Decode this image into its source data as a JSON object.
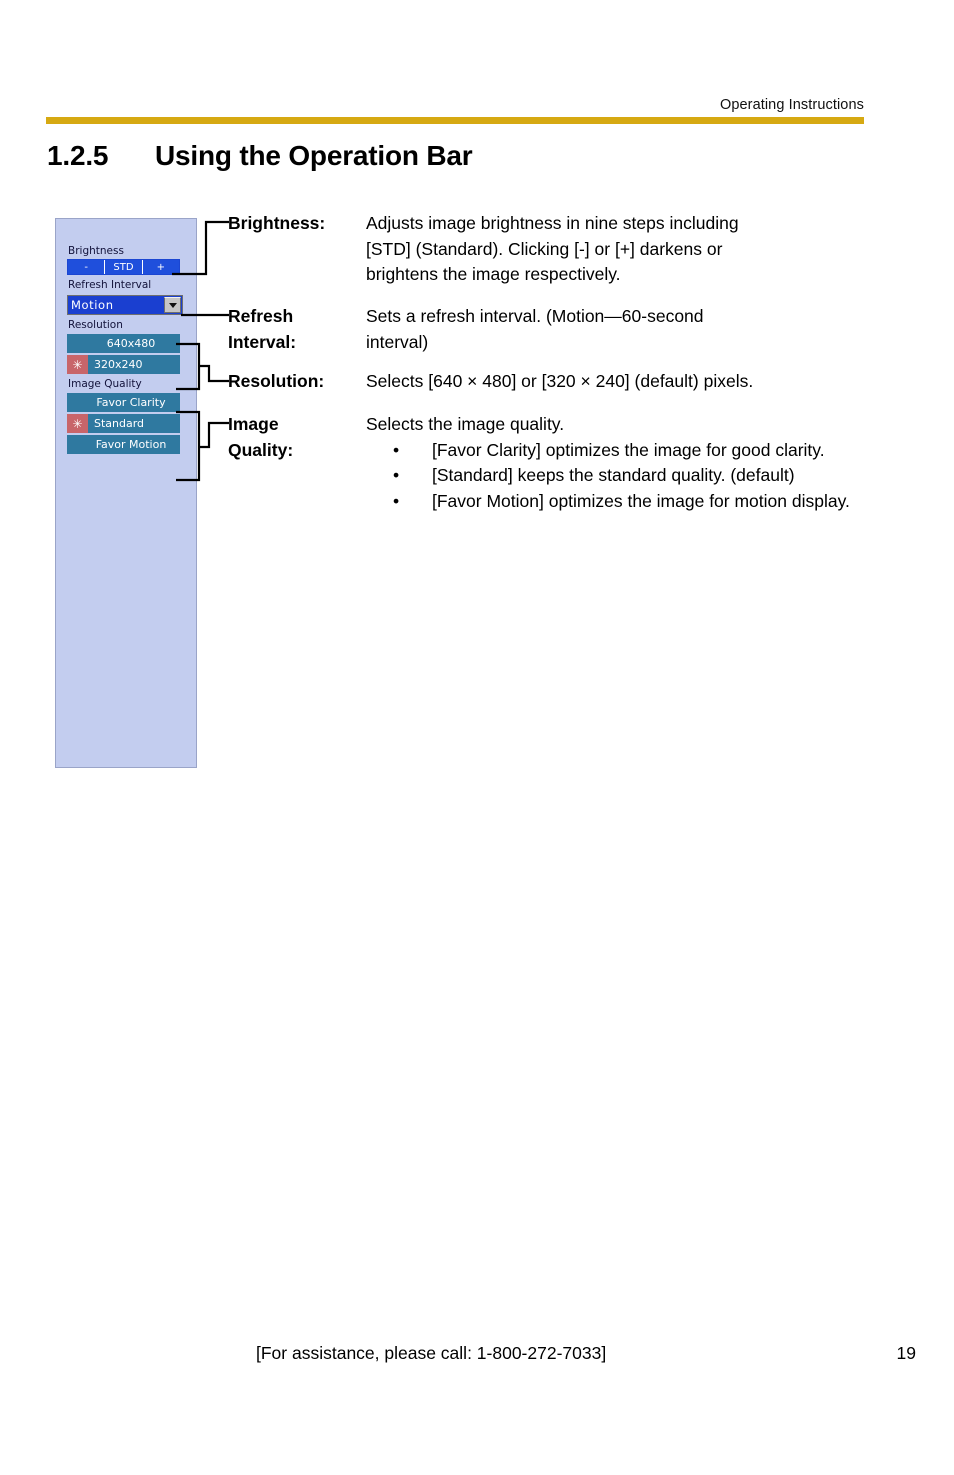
{
  "header": {
    "title": "Operating Instructions",
    "rule_color": "#d6a912"
  },
  "section": {
    "number": "1.2.5",
    "title": "Using the Operation Bar"
  },
  "operation_bar": {
    "panel_bg_color": "#c3cdef",
    "brightness": {
      "label": "Brightness",
      "segments": [
        {
          "label": "-",
          "name": "decrease"
        },
        {
          "label": "STD",
          "name": "standard"
        },
        {
          "label": "+",
          "name": "increase"
        }
      ],
      "color": "#1f4fdc"
    },
    "refresh_interval": {
      "label": "Refresh Interval",
      "selected": "Motion",
      "arrow_icon": "chevron-down-icon"
    },
    "resolution": {
      "label": "Resolution",
      "options": [
        {
          "label": "640x480",
          "selected": false
        },
        {
          "label": "320x240",
          "selected": true
        }
      ],
      "marker_glyph": "✳",
      "marker_color": "#c8656a",
      "button_color": "#2f79a0"
    },
    "image_quality": {
      "label": "Image Quality",
      "options": [
        {
          "label": "Favor Clarity",
          "selected": false
        },
        {
          "label": "Standard",
          "selected": true
        },
        {
          "label": "Favor Motion",
          "selected": false
        }
      ]
    }
  },
  "definitions": {
    "brightness": {
      "term": "Brightness:",
      "lines": [
        "Adjusts image brightness in nine steps including",
        "[STD] (Standard). Clicking [-] or [+] darkens or",
        "brightens the image respectively."
      ]
    },
    "refresh_interval": {
      "term_line1": "Refresh",
      "term_line2": "Interval:",
      "lines": [
        "Sets a refresh interval. (Motion—60-second",
        "interval)"
      ]
    },
    "resolution": {
      "term": "Resolution:",
      "lines": [
        "Selects [640 × 480] or [320 × 240] (default) pixels."
      ]
    },
    "image_quality": {
      "term_line1": "Image",
      "term_line2": "Quality:",
      "intro": "Selects the image quality.",
      "bullet_glyph": "•",
      "bullets": [
        "[Favor Clarity] optimizes the image for good clarity.",
        "[Standard] keeps the standard quality. (default)",
        "[Favor Motion] optimizes the image for motion display."
      ]
    }
  },
  "footer": {
    "assistance": "[For assistance, please call: 1-800-272-7033]",
    "page_number": "19"
  }
}
